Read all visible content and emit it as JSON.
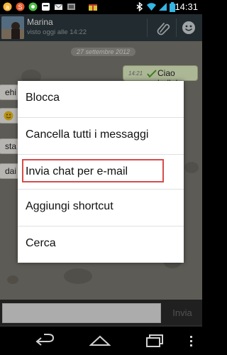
{
  "status_bar": {
    "time": "14:31",
    "icons": [
      "app-icon-1",
      "app-icon-2",
      "app-icon-3",
      "app-icon-4",
      "mail-icon",
      "gift-icon",
      "app-icon-5",
      "bluetooth-icon",
      "wifi-icon",
      "signal-icon",
      "battery-icon"
    ]
  },
  "header": {
    "contact_name": "Marina",
    "last_seen": "visto oggi alle 14:22",
    "icons": [
      "paperclip-icon",
      "emoji-icon"
    ]
  },
  "chat": {
    "date": "27 settembre 2012",
    "outgoing": {
      "time": "14:21",
      "text": "Ciao bella!"
    },
    "incoming": [
      {
        "text": "ehi"
      },
      {
        "text": ""
      },
      {
        "text": "sta"
      },
      {
        "text": "dai"
      }
    ]
  },
  "menu": {
    "items": [
      {
        "label": "Blocca"
      },
      {
        "label": "Cancella tutti i messaggi"
      },
      {
        "label": "Invia chat per e-mail"
      },
      {
        "label": "Aggiungi shortcut"
      },
      {
        "label": "Cerca"
      }
    ],
    "highlighted_index": 2,
    "highlight_color": "#d84b4b"
  },
  "input_bar": {
    "placeholder": "",
    "send_label": "Invia"
  },
  "navbar": {
    "icons": [
      "back-icon",
      "home-icon",
      "recents-icon",
      "menu-icon"
    ]
  },
  "colors": {
    "header_bg": "#2c3a40",
    "chat_bg": "#7d7a72",
    "bubble_out": "#e6f4c8",
    "bubble_in": "#f4f2ee"
  }
}
